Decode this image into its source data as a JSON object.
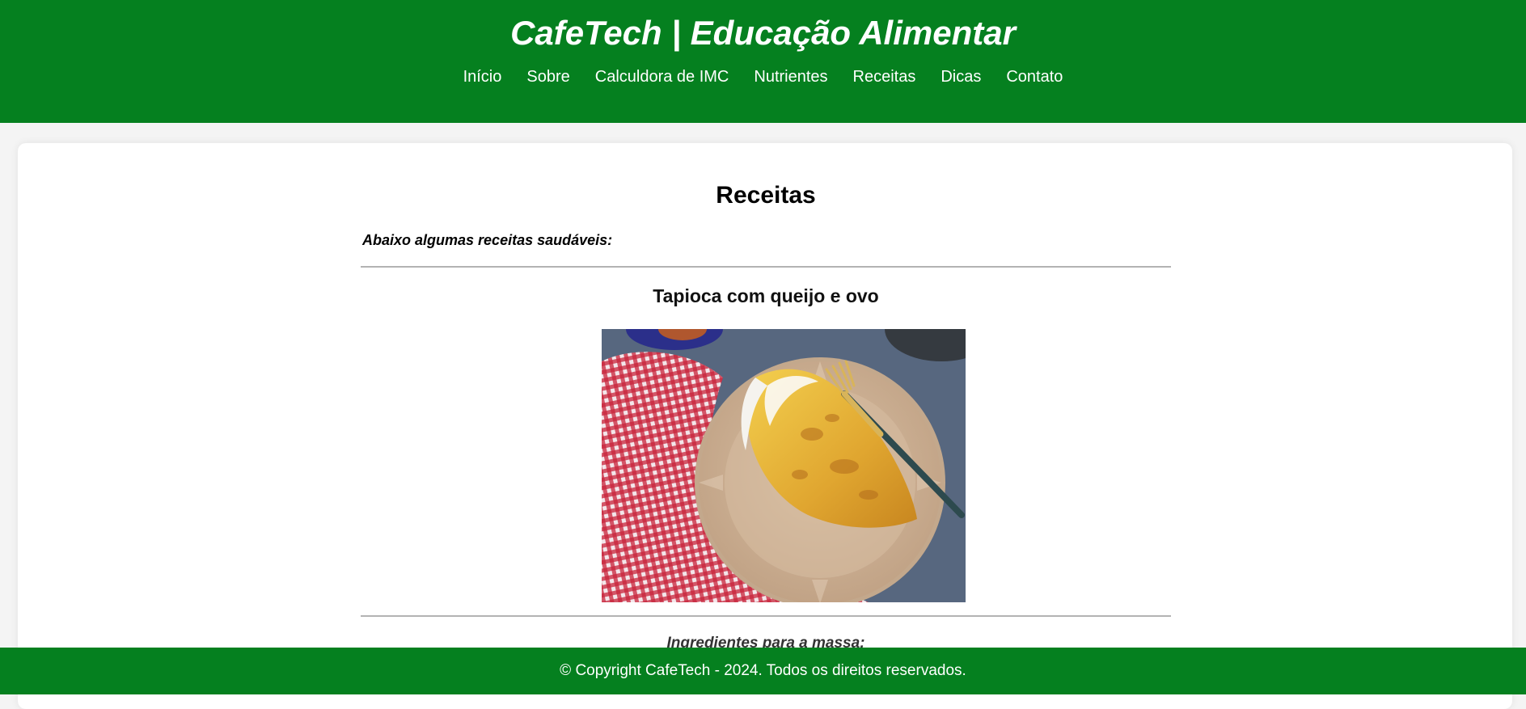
{
  "header": {
    "title": "CafeTech | Educação Alimentar",
    "nav": [
      {
        "label": "Início"
      },
      {
        "label": "Sobre"
      },
      {
        "label": "Calculdora de IMC"
      },
      {
        "label": "Nutrientes"
      },
      {
        "label": "Receitas"
      },
      {
        "label": "Dicas"
      },
      {
        "label": "Contato"
      }
    ]
  },
  "main": {
    "section_title": "Receitas",
    "intro": "Abaixo algumas receitas saudáveis:",
    "recipe": {
      "title": "Tapioca com queijo e ovo",
      "image_subject": "tapioca-plate-photo",
      "ingredients_heading": "Ingredientes para a massa:"
    }
  },
  "footer": {
    "text": "© Copyright CafeTech - 2024. Todos os direitos reservados."
  },
  "colors": {
    "brand_green": "#05801f",
    "page_background": "#f4f4f4",
    "card_background": "#ffffff",
    "rule": "#b3b3b3"
  }
}
